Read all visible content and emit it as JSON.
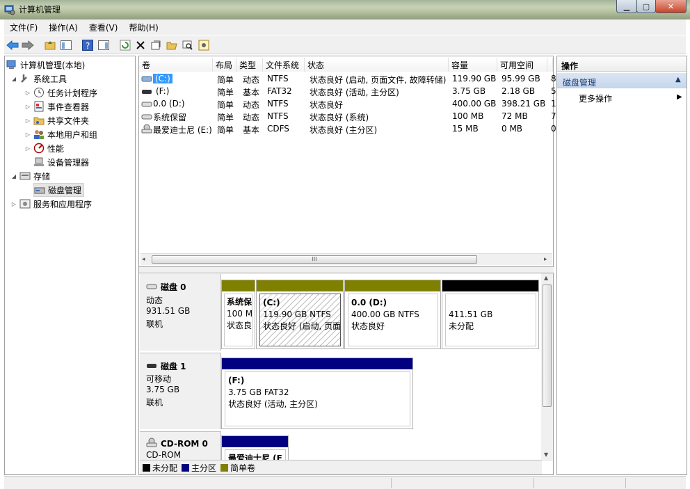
{
  "window": {
    "title": "计算机管理"
  },
  "menu": [
    "文件(F)",
    "操作(A)",
    "查看(V)",
    "帮助(H)"
  ],
  "tree": {
    "root": "计算机管理(本地)",
    "system_tools": "系统工具",
    "task_scheduler": "任务计划程序",
    "event_viewer": "事件查看器",
    "shared_folders": "共享文件夹",
    "local_users": "本地用户和组",
    "performance": "性能",
    "device_manager": "设备管理器",
    "storage": "存储",
    "disk_management": "磁盘管理",
    "services": "服务和应用程序"
  },
  "volume_table": {
    "columns": [
      "卷",
      "布局",
      "类型",
      "文件系统",
      "状态",
      "容量",
      "可用空间",
      ""
    ],
    "rows": [
      {
        "name": "(C:)",
        "layout": "简单",
        "type": "动态",
        "fs": "NTFS",
        "status": "状态良好 (启动, 页面文件, 故障转储)",
        "capacity": "119.90 GB",
        "free": "95.99 GB",
        "extra": "8"
      },
      {
        "name": "(F:)",
        "layout": "简单",
        "type": "基本",
        "fs": "FAT32",
        "status": "状态良好 (活动, 主分区)",
        "capacity": "3.75 GB",
        "free": "2.18 GB",
        "extra": "5"
      },
      {
        "name": "0.0 (D:)",
        "layout": "简单",
        "type": "动态",
        "fs": "NTFS",
        "status": "状态良好",
        "capacity": "400.00 GB",
        "free": "398.21 GB",
        "extra": "1"
      },
      {
        "name": "系统保留",
        "layout": "简单",
        "type": "动态",
        "fs": "NTFS",
        "status": "状态良好 (系统)",
        "capacity": "100 MB",
        "free": "72 MB",
        "extra": "7"
      },
      {
        "name": "最爱迪士尼 (E:)",
        "layout": "简单",
        "type": "基本",
        "fs": "CDFS",
        "status": "状态良好 (主分区)",
        "capacity": "15 MB",
        "free": "0 MB",
        "extra": "0"
      }
    ]
  },
  "disks": [
    {
      "name": "磁盘 0",
      "kind": "动态",
      "size": "931.51 GB",
      "state": "联机",
      "parts": [
        {
          "l1": "系统保",
          "l2": "100 M",
          "l3": "状态良"
        },
        {
          "l1": "(C:)",
          "l2": "119.90 GB NTFS",
          "l3": "状态良好 (启动, 页面"
        },
        {
          "l1": "0.0  (D:)",
          "l2": "400.00 GB NTFS",
          "l3": "状态良好"
        },
        {
          "l1": "",
          "l2": "411.51 GB",
          "l3": "未分配"
        }
      ]
    },
    {
      "name": "磁盘 1",
      "kind": "可移动",
      "size": "3.75 GB",
      "state": "联机",
      "parts": [
        {
          "l1": "(F:)",
          "l2": "3.75 GB FAT32",
          "l3": "状态良好 (活动, 主分区)"
        }
      ]
    },
    {
      "name": "CD-ROM 0",
      "kind": "CD-ROM",
      "parts": [
        {
          "l1": "最爱迪士尼 (E"
        }
      ]
    }
  ],
  "legend": [
    "未分配",
    "主分区",
    "简单卷"
  ],
  "colors": {
    "unallocated": "#000000",
    "primary": "#000080",
    "simple": "#808000"
  },
  "actions": {
    "header": "操作",
    "section": "磁盘管理",
    "more": "更多操作"
  },
  "scroll_label": "III"
}
